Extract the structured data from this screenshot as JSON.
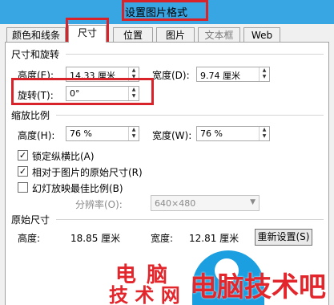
{
  "window": {
    "title": "设置图片格式"
  },
  "tabs": [
    {
      "label": "颜色和线条"
    },
    {
      "label": "尺寸"
    },
    {
      "label": "位置"
    },
    {
      "label": "图片"
    },
    {
      "label": "文本框"
    },
    {
      "label": "Web"
    }
  ],
  "size_rotate": {
    "heading": "尺寸和旋转",
    "height_label": "高度(E):",
    "height_value": "14.33 厘米",
    "width_label": "宽度(D):",
    "width_value": "9.74 厘米",
    "rotate_label": "旋转(T):",
    "rotate_value": "0°"
  },
  "scale": {
    "heading": "缩放比例",
    "height_label": "高度(H):",
    "height_value": "76 %",
    "width_label": "宽度(W):",
    "width_value": "76 %",
    "lock_aspect": {
      "label": "锁定纵横比(A)",
      "checked": true
    },
    "relative_original": {
      "label": "相对于图片的原始尺寸(R)",
      "checked": true
    },
    "slideshow_best": {
      "label": "幻灯放映最佳比例(B)",
      "checked": false
    },
    "resolution_label": "分辨率(O):",
    "resolution_value": "640×480"
  },
  "original": {
    "heading": "原始尺寸",
    "height_label": "高度:",
    "height_value": "18.85 厘米",
    "width_label": "宽度:",
    "width_value": "12.81 厘米",
    "reset_label": "重新设置(S)"
  },
  "watermark": {
    "left_top": "电 脑",
    "left_bottom": "技 术 网",
    "right": "电脑技术吧"
  },
  "colors": {
    "titlebar": "#37a6e3",
    "highlight": "#d9232b",
    "watermark_red": "#e3262b",
    "watermark_blue": "#1b63c6"
  },
  "icons": {
    "spin_up": "triangle-up",
    "spin_down": "triangle-down",
    "checkbox_checked": "check-mark",
    "dropdown": "chevron-down"
  }
}
